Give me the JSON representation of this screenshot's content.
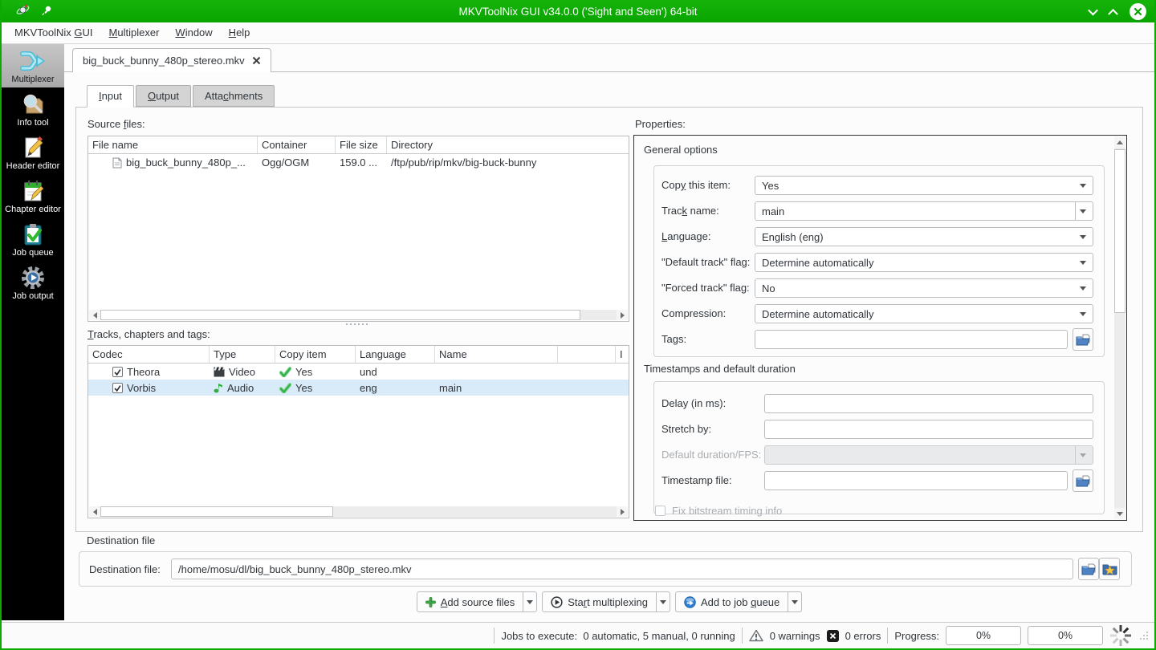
{
  "window": {
    "title": "MKVToolNix GUI v34.0.0 ('Sight and Seen') 64-bit"
  },
  "menu": {
    "items": [
      {
        "pre": "MKVToolNix ",
        "mn": "G",
        "post": "UI"
      },
      {
        "pre": "",
        "mn": "M",
        "post": "ultiplexer"
      },
      {
        "pre": "",
        "mn": "W",
        "post": "indow"
      },
      {
        "pre": "",
        "mn": "H",
        "post": "elp"
      }
    ]
  },
  "sidebar": {
    "items": [
      {
        "label": "Multiplexer"
      },
      {
        "label": "Info tool"
      },
      {
        "label": "Header editor"
      },
      {
        "label": "Chapter editor"
      },
      {
        "label": "Job queue"
      },
      {
        "label": "Job output"
      }
    ]
  },
  "doc_tab": {
    "title": "big_buck_bunny_480p_stereo.mkv"
  },
  "tabs": [
    {
      "pre": "",
      "mn": "I",
      "post": "nput"
    },
    {
      "pre": "",
      "mn": "O",
      "post": "utput"
    },
    {
      "pre": "Atta",
      "mn": "c",
      "post": "hments"
    }
  ],
  "source_files": {
    "label": {
      "pre": "Source ",
      "mn": "f",
      "post": "iles:"
    },
    "columns": [
      "File name",
      "Container",
      "File size",
      "Directory"
    ],
    "rows": [
      {
        "file_name": "big_buck_bunny_480p_...",
        "container": "Ogg/OGM",
        "file_size": "159.0 ...",
        "directory": "/ftp/pub/rip/mkv/big-buck-bunny"
      }
    ]
  },
  "tracks": {
    "label": {
      "pre": "",
      "mn": "T",
      "post": "racks, chapters and tags:"
    },
    "columns": {
      "codec": "Codec",
      "type": "Type",
      "copy": "Copy item",
      "language": "Language",
      "name": "Name",
      "id": "I"
    },
    "rows": [
      {
        "codec": "Theora",
        "type": "Video",
        "copy": "Yes",
        "language": "und",
        "name": ""
      },
      {
        "codec": "Vorbis",
        "type": "Audio",
        "copy": "Yes",
        "language": "eng",
        "name": "main"
      }
    ]
  },
  "properties": {
    "label": "Properties:",
    "general": {
      "title": "General options",
      "copy_item": {
        "pre": "Cop",
        "mn": "y",
        "post": " this item:",
        "value": "Yes"
      },
      "track_name": {
        "pre": "Trac",
        "mn": "k",
        "post": " name:",
        "value": "main"
      },
      "language": {
        "pre": "",
        "mn": "L",
        "post": "anguage:",
        "value": "English (eng)"
      },
      "default_flag": {
        "label": "\"Default track\" flag:",
        "value": "Determine automatically"
      },
      "forced_flag": {
        "label": "\"Forced track\" flag:",
        "value": "No"
      },
      "compression": {
        "label": "Compression:",
        "value": "Determine automatically"
      },
      "tags": {
        "label": "Tags:",
        "value": ""
      }
    },
    "timestamps": {
      "title": "Timestamps and default duration",
      "delay": {
        "label": "Delay (in ms):",
        "value": ""
      },
      "stretch": {
        "label": "Stretch by:",
        "value": ""
      },
      "default_duration": {
        "label": "Default duration/FPS:",
        "value": ""
      },
      "timestamp_file": {
        "label": "Timestamp file:",
        "value": ""
      },
      "fix_bitstream": {
        "label": "Fix bitstream timing info"
      }
    }
  },
  "destination": {
    "group_title": "Destination file",
    "label": "Destination file:",
    "value": "/home/mosu/dl/big_buck_bunny_480p_stereo.mkv"
  },
  "actions": [
    {
      "pre": "",
      "mn": "A",
      "post": "dd source files"
    },
    {
      "pre": "Sta",
      "mn": "r",
      "post": "t multiplexing"
    },
    {
      "pre": "Add to job ",
      "mn": "q",
      "post": "ueue"
    }
  ],
  "status": {
    "jobs": "Jobs to execute:  0 automatic, 5 manual, 0 running",
    "warnings": "0 warnings",
    "errors": "0 errors",
    "progress_label": "Progress:",
    "progress1": "0%",
    "progress2": "0%"
  }
}
